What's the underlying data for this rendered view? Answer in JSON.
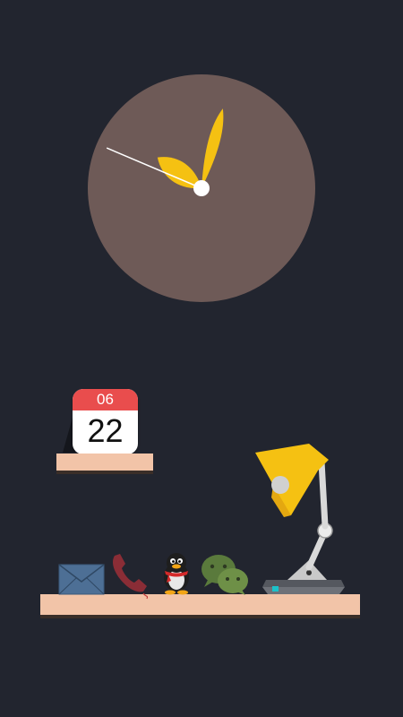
{
  "calendar": {
    "month": "06",
    "day": "22"
  },
  "clock": {
    "hour_hand_angle": -55,
    "minute_hand_angle": 15,
    "second_hand_angle": -67
  },
  "colors": {
    "background": "#22252f",
    "clock_face": "#6e5a57",
    "hand": "#f5c112",
    "shelf": "#f2c4a8",
    "calendar_header": "#e94d4d"
  },
  "dock": {
    "icons": [
      "envelope-icon",
      "phone-icon",
      "penguin-icon",
      "chat-bubbles-icon",
      "desk-lamp-icon"
    ]
  }
}
